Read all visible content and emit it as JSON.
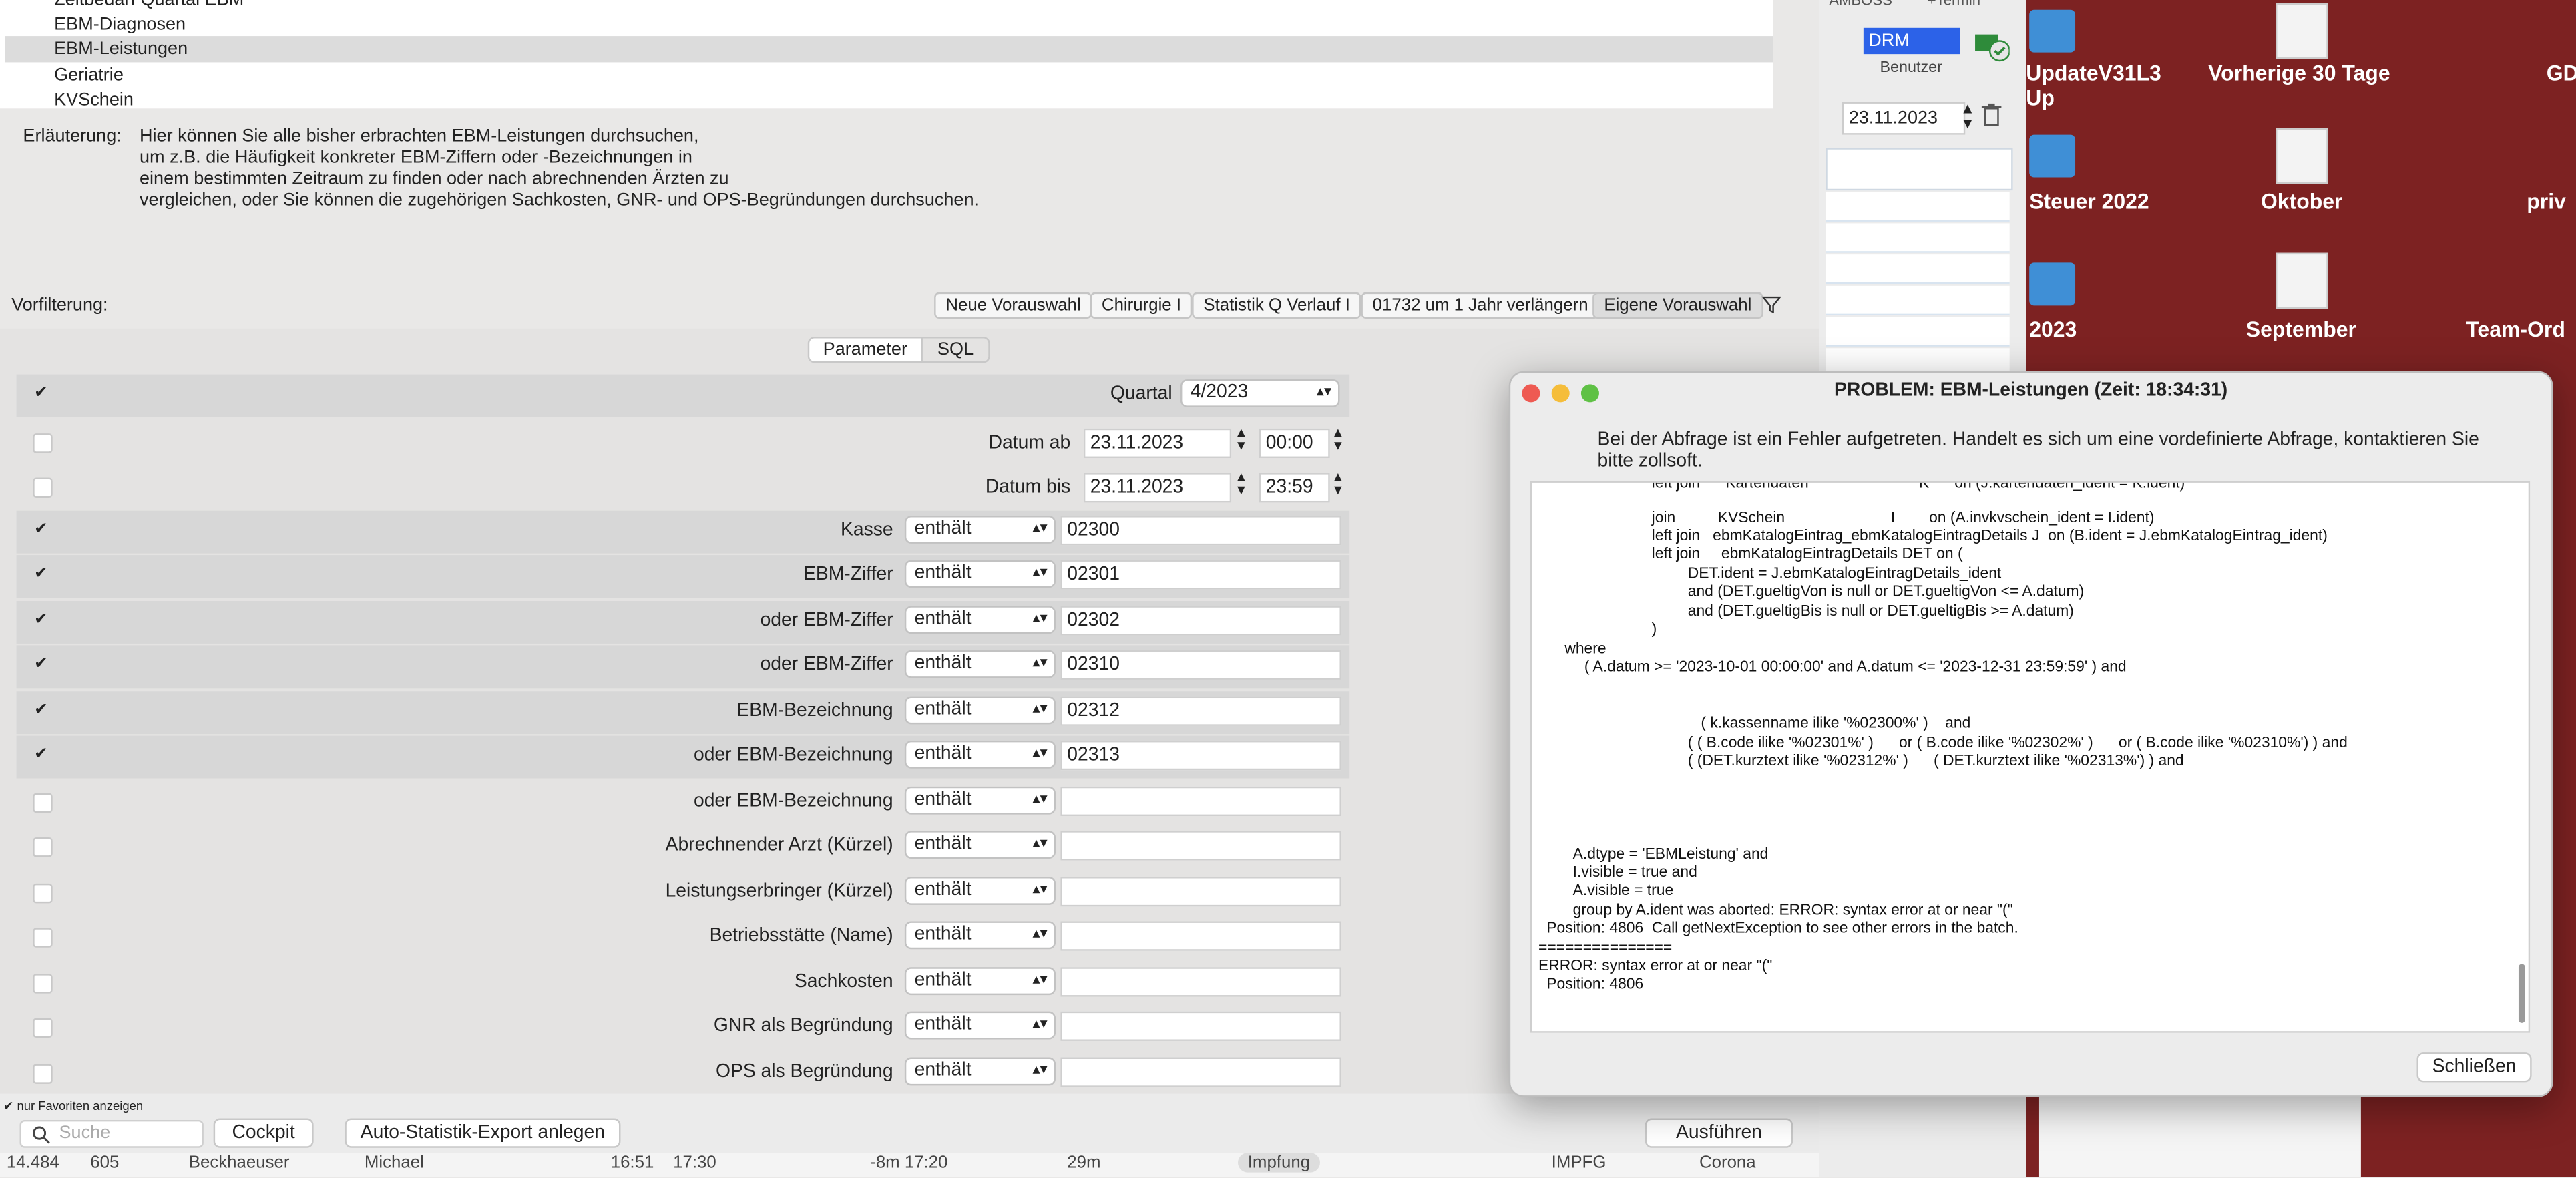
{
  "list": {
    "items": [
      "Zeitbedarf Quartal EBM",
      "EBM-Diagnosen",
      "EBM-Leistungen",
      "Geriatrie",
      "KVSchein"
    ],
    "selected_index": 2
  },
  "explanation": {
    "label": "Erläuterung:",
    "lines": [
      "Hier können Sie alle bisher erbrachten EBM-Leistungen durchsuchen,",
      "um z.B. die Häufigkeit konkreter EBM-Ziffern oder -Bezeichnungen in",
      "einem bestimmten Zeitraum zu finden oder nach abrechnenden Ärzten zu",
      "vergleichen, oder Sie können die zugehörigen Sachkosten, GNR- und OPS-Begründungen durchsuchen."
    ]
  },
  "prefilter": {
    "label": "Vorfilterung:",
    "buttons": [
      "Neue Vorauswahl",
      "Chirurgie I",
      "Statistik Q Verlauf I",
      "01732 um 1 Jahr verlängern",
      "Eigene Vorauswahl"
    ],
    "active": "Eigene Vorauswahl"
  },
  "tabs": {
    "parameter": "Parameter",
    "sql": "SQL",
    "active": "Parameter"
  },
  "params": {
    "quartal": {
      "label": "Quartal",
      "value": "4/2023",
      "checked": true
    },
    "datum_ab": {
      "label": "Datum ab",
      "date": "23.11.2023",
      "time": "00:00",
      "checked": false
    },
    "datum_bis": {
      "label": "Datum bis",
      "date": "23.11.2023",
      "time": "23:59",
      "checked": false
    },
    "rows": [
      {
        "label": "Kasse",
        "op": "enthält",
        "value": "02300",
        "checked": true
      },
      {
        "label": "EBM-Ziffer",
        "op": "enthält",
        "value": "02301",
        "checked": true
      },
      {
        "label": "oder EBM-Ziffer",
        "op": "enthält",
        "value": "02302",
        "checked": true
      },
      {
        "label": "oder EBM-Ziffer",
        "op": "enthält",
        "value": "02310",
        "checked": true
      },
      {
        "label": "EBM-Bezeichnung",
        "op": "enthält",
        "value": "02312",
        "checked": true
      },
      {
        "label": "oder EBM-Bezeichnung",
        "op": "enthält",
        "value": "02313",
        "checked": true
      },
      {
        "label": "oder EBM-Bezeichnung",
        "op": "enthält",
        "value": "",
        "checked": false
      },
      {
        "label": "Abrechnender Arzt (Kürzel)",
        "op": "enthält",
        "value": "",
        "checked": false
      },
      {
        "label": "Leistungserbringer (Kürzel)",
        "op": "enthält",
        "value": "",
        "checked": false
      },
      {
        "label": "Betriebsstätte (Name)",
        "op": "enthält",
        "value": "",
        "checked": false
      },
      {
        "label": "Sachkosten",
        "op": "enthält",
        "value": "",
        "checked": false
      },
      {
        "label": "GNR als Begründung",
        "op": "enthält",
        "value": "",
        "checked": false
      },
      {
        "label": "OPS als Begründung",
        "op": "enthält",
        "value": "",
        "checked": false
      }
    ]
  },
  "footer": {
    "favorites_checkbox": "nur Favoriten anzeigen",
    "search_placeholder": "Suche",
    "cockpit": "Cockpit",
    "auto_export": "Auto-Statistik-Export anlegen",
    "run": "Ausführen"
  },
  "bottom_row": {
    "cells": [
      "14.484",
      "605",
      "Beckhaeuser",
      "Michael",
      "16:51",
      "17:30",
      "-8m  17:20",
      "29m",
      "Impfung",
      "IMPFG",
      "Corona"
    ]
  },
  "background_app": {
    "user_code": "DRM",
    "user_label": "Benutzer",
    "date": "23.11.2023",
    "top_labels": [
      "AMBOSS",
      "+Termin"
    ]
  },
  "desktop": {
    "labels": [
      "UpdateV31L3",
      "Up",
      "Vorherige 30 Tage",
      "GD",
      "Steuer 2022",
      "Oktober",
      "priv",
      "2023",
      "September",
      "Team-Ord"
    ]
  },
  "dialog": {
    "title": "PROBLEM: EBM-Leistungen  (Zeit: 18:34:31)",
    "message": "Bei der Abfrage ist ein Fehler aufgetreten. Handelt es sich um eine vordefinierte Abfrage, kontaktieren Sie bitte zollsoft.",
    "close": "Schließen",
    "sql_lines": [
      "left join      Kartendaten                          K      on (J.kartendaten_ident = K.ident)",
      "join          KVSchein                         I        on (A.invkvschein_ident = I.ident)",
      "left join   ebmKatalogEintrag_ebmKatalogEintragDetails J  on (B.ident = J.ebmKatalogEintrag_ident)",
      "left join     ebmKatalogEintragDetails DET on (",
      "DET.ident = J.ebmKatalogEintragDetails_ident",
      "and (DET.gueltigVon is null or DET.gueltigVon <= A.datum)",
      "and (DET.gueltigBis is null or DET.gueltigBis >= A.datum)",
      ")",
      "where",
      "( A.datum >= '2023-10-01 00:00:00' and A.datum <= '2023-12-31 23:59:59' ) and",
      "( k.kassenname ilike '%02300%' )    and",
      "( ( B.code ilike '%02301%' )      or ( B.code ilike '%02302%' )      or ( B.code ilike '%02310%') ) and",
      "( (DET.kurztext ilike '%02312%' )      ( DET.kurztext ilike '%02313%') ) and",
      "A.dtype = 'EBMLeistung' and",
      "I.visible = true and",
      "A.visible = true",
      "group by A.ident was aborted: ERROR: syntax error at or near \"(\"",
      "Position: 4806  Call getNextException to see other errors in the batch.",
      "===============",
      "ERROR: syntax error at or near \"(\"",
      "Position: 4806"
    ]
  }
}
